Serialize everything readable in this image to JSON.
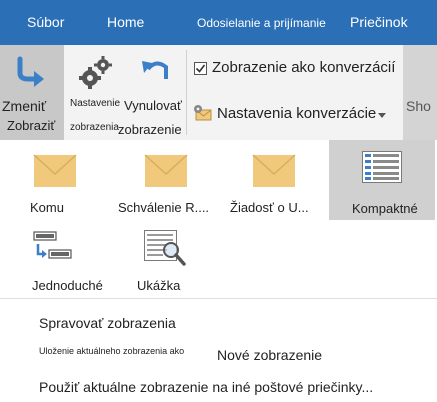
{
  "tabs": [
    "Súbor",
    "Home",
    "Odosielanie a prijímanie",
    "Priečinok"
  ],
  "ribbon": {
    "change_view": {
      "line1": "Zmeniť",
      "line2": "Zobraziť"
    },
    "view_settings": {
      "line1": "Nastavenie",
      "line2": "zobrazenia"
    },
    "reset_view": {
      "line1": "Vynulovať",
      "line2": "zobrazenie"
    },
    "conversation_view": {
      "label": "Zobrazenie ako konverzácií",
      "checked": true
    },
    "conversation_settings": {
      "label": "Nastavenia konverzácie"
    },
    "cut_off": "Sho"
  },
  "views": [
    {
      "label": "Komu",
      "icon": "envelope-icon"
    },
    {
      "label": "Schválenie R....",
      "icon": "envelope-icon"
    },
    {
      "label": "Žiadosť o U...",
      "icon": "envelope-icon"
    },
    {
      "label": "Kompaktné",
      "icon": "compact-list-icon",
      "selected": true
    },
    {
      "label": "Jednoduché",
      "icon": "simple-list-icon"
    },
    {
      "label": "Ukážka",
      "icon": "preview-icon"
    }
  ],
  "menu": {
    "manage_views": "Spravovať zobrazenia",
    "save_prefix": "Uloženie aktuálneho zobrazenia ako",
    "save_suffix": "Nové zobrazenie",
    "apply_view": "Použiť aktuálne zobrazenie na iné poštové priečinky..."
  },
  "colors": {
    "tab_bar": "#2b6fb7",
    "accent": "#3a7fc8",
    "envelope": "#f0c97c"
  }
}
